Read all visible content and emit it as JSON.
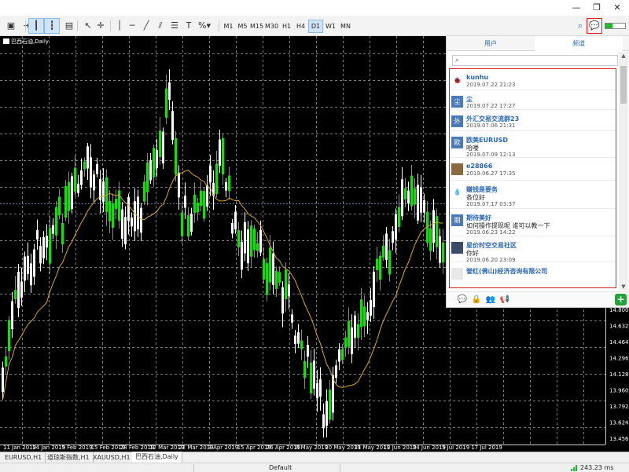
{
  "toolbar": {
    "timeframes": [
      "M1",
      "M5",
      "M15",
      "M30",
      "H1",
      "H4",
      "D1",
      "W1",
      "MN"
    ],
    "selected_timeframe": "D1",
    "window_controls": [
      "minimize-icon",
      "maximize-icon",
      "close-icon"
    ]
  },
  "chart": {
    "title": "巴西石油,Daily",
    "price_labels": [
      "14.800",
      "14.632",
      "14.464",
      "14.296",
      "14.128",
      "13.960",
      "13.792",
      "13.624",
      "13.456"
    ],
    "date_labels": [
      "11 Jan 2019",
      "24 Jan 2019",
      "5 Feb 2019",
      "15 Feb 2019",
      "28 Feb 2019",
      "12 Mar 2019",
      "22 Mar 2019",
      "3 Apr 2019",
      "15 Apr 2019",
      "26 Apr 2019",
      "8 May 2019",
      "20 May 2019",
      "31 May 2019",
      "12 Jun 2019",
      "24 Jun 2019",
      "5 Jul 2019",
      "17 Jul 2019"
    ],
    "colors": {
      "bull": "#22d41a",
      "bear": "#ffffff",
      "ma": "#d9a81a",
      "grid": "#7a7a7a",
      "bg": "#000000"
    }
  },
  "chat": {
    "tabs": [
      "用户",
      "频道"
    ],
    "active_tab": "频道",
    "items": [
      {
        "name": "kunhu",
        "message": "",
        "date": "2019.07.22 21:23",
        "avatar_text": "🐞",
        "avatar_color": "#ffffff"
      },
      {
        "name": "尘",
        "message": "",
        "date": "2019.07.22 17:27",
        "avatar_text": "尘",
        "avatar_color": "#4a7ab8"
      },
      {
        "name": "外汇交易交流群23",
        "message": "",
        "date": "2019.07.06 21:31",
        "avatar_text": "外",
        "avatar_color": "#4a7ab8"
      },
      {
        "name": "欧美EURUSD",
        "message": "哈喽",
        "date": "2019.07.09 12:13",
        "avatar_text": "欧",
        "avatar_color": "#4a7ab8"
      },
      {
        "name": "e28866",
        "message": "",
        "date": "2019.06.27 17:35",
        "avatar_text": "",
        "avatar_color": "#8a6a40"
      },
      {
        "name": "赚钱是要务",
        "message": "各位好",
        "date": "2019.07.17 03:37",
        "avatar_text": "💧",
        "avatar_color": "#ffffff"
      },
      {
        "name": "期待美好",
        "message": "如何操作提现呢 谁可以教一下",
        "date": "2019.06.23 14:22",
        "avatar_text": "期",
        "avatar_color": "#4a7ab8"
      },
      {
        "name": "星价时空交易社区",
        "message": "你好",
        "date": "2019.06.20 23:09",
        "avatar_text": "",
        "avatar_color": "#3a4c6a"
      },
      {
        "name": "誉红(佛山)经济咨询有限公司",
        "message": "",
        "date": "",
        "avatar_text": "",
        "avatar_color": "#e8e8e8"
      }
    ]
  },
  "sheet_tabs": [
    "EURUSD,H1",
    "道琼斯指数,H1",
    "XAUUSD,H1",
    "巴西石油,Daily"
  ],
  "active_sheet": "巴西石油,Daily",
  "status": {
    "profile": "Default",
    "ping": "243.23 ms"
  }
}
